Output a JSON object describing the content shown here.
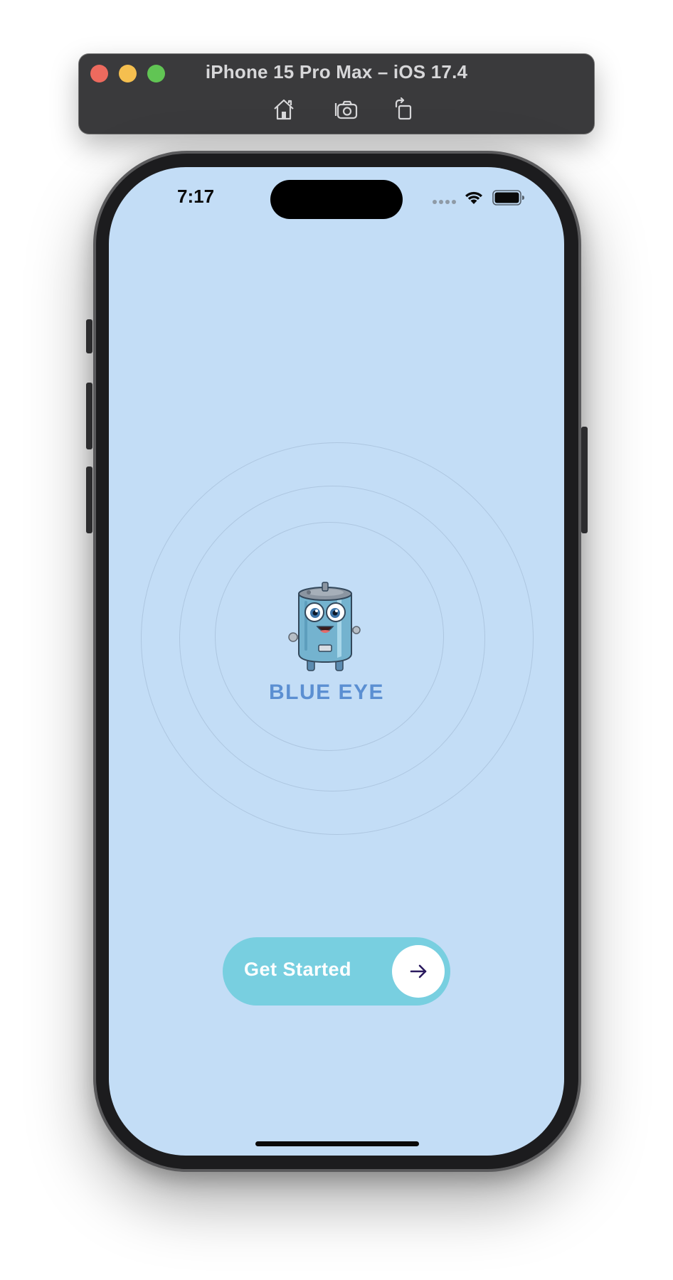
{
  "simulator": {
    "window_title": "iPhone 15 Pro Max – iOS 17.4",
    "toolbar": [
      {
        "icon": "home-icon"
      },
      {
        "icon": "screenshot-icon"
      },
      {
        "icon": "rotate-icon"
      }
    ]
  },
  "status_bar": {
    "time": "7:17",
    "icons": [
      "signal-dots-icon",
      "wifi-icon",
      "battery-icon"
    ]
  },
  "splash": {
    "brand_name": "BLUE EYE",
    "mascot": "water-heater-mascot",
    "brand_color": "#5b8fd2",
    "background_color": "#c3ddf6"
  },
  "cta": {
    "label": "Get Started",
    "icon": "arrow-right-icon",
    "button_color": "#78cfe0",
    "arrow_color": "#2b1a5e"
  }
}
